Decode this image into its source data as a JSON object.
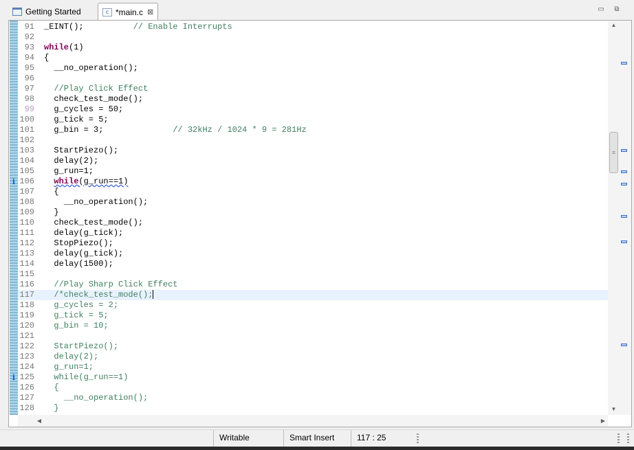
{
  "tabs": [
    {
      "label": "Getting Started",
      "icon": "window-icon",
      "active": false
    },
    {
      "label": "*main.c",
      "icon": "c-file-icon",
      "active": true,
      "close": "⊠",
      "file_letter": "c"
    }
  ],
  "view_controls": {
    "minimize": "▭",
    "maximize": "⧉"
  },
  "editor": {
    "annotation_marker": "i",
    "lines": [
      {
        "n": "91",
        "t": "_EINT();          // Enable Interrupts"
      },
      {
        "n": "92",
        "t": ""
      },
      {
        "n": "93",
        "t": "while(1)"
      },
      {
        "n": "94",
        "t": "{"
      },
      {
        "n": "95",
        "t": "  __no_operation();"
      },
      {
        "n": "96",
        "t": ""
      },
      {
        "n": "97",
        "t": "  //Play Click Effect"
      },
      {
        "n": "98",
        "t": "  check_test_mode();"
      },
      {
        "n": "99",
        "t": "  g_cycles = 50;"
      },
      {
        "n": "100",
        "t": "  g_tick = 5;"
      },
      {
        "n": "101",
        "t": "  g_bin = 3;              // 32kHz / 1024 * 9 = 281Hz"
      },
      {
        "n": "102",
        "t": ""
      },
      {
        "n": "103",
        "t": "  StartPiezo();"
      },
      {
        "n": "104",
        "t": "  delay(2);"
      },
      {
        "n": "105",
        "t": "  g_run=1;"
      },
      {
        "n": "106",
        "t": "  while(g_run==1)"
      },
      {
        "n": "107",
        "t": "  {"
      },
      {
        "n": "108",
        "t": "    __no_operation();"
      },
      {
        "n": "109",
        "t": "  }"
      },
      {
        "n": "110",
        "t": "  check_test_mode();"
      },
      {
        "n": "111",
        "t": "  delay(g_tick);"
      },
      {
        "n": "112",
        "t": "  StopPiezo();"
      },
      {
        "n": "113",
        "t": "  delay(g_tick);"
      },
      {
        "n": "114",
        "t": "  delay(1500);"
      },
      {
        "n": "115",
        "t": ""
      },
      {
        "n": "116",
        "t": "  //Play Sharp Click Effect"
      },
      {
        "n": "117",
        "t": "  /*check_test_mode();"
      },
      {
        "n": "118",
        "t": "  g_cycles = 2;"
      },
      {
        "n": "119",
        "t": "  g_tick = 5;"
      },
      {
        "n": "120",
        "t": "  g_bin = 10;"
      },
      {
        "n": "121",
        "t": ""
      },
      {
        "n": "122",
        "t": "  StartPiezo();"
      },
      {
        "n": "123",
        "t": "  delay(2);"
      },
      {
        "n": "124",
        "t": "  g_run=1;"
      },
      {
        "n": "125",
        "t": "  while(g_run==1)"
      },
      {
        "n": "126",
        "t": "  {"
      },
      {
        "n": "127",
        "t": "    __no_operation();"
      },
      {
        "n": "128",
        "t": "  }"
      }
    ]
  },
  "scrollbar": {
    "grip": "≡",
    "up": "▲",
    "down": "▼",
    "left": "◀",
    "right": "▶"
  },
  "status": {
    "writable": "Writable",
    "insert_mode": "Smart Insert",
    "cursor_position": "117 : 25"
  }
}
